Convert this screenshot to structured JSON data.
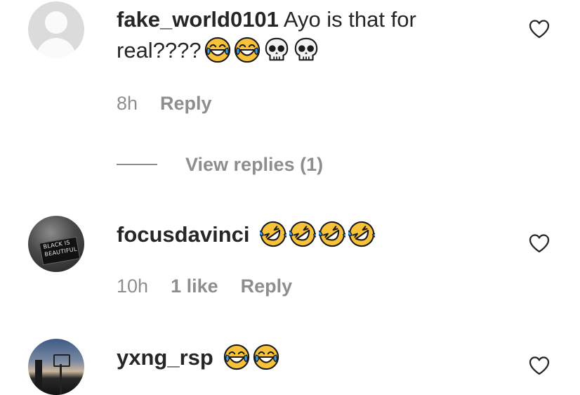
{
  "comments": [
    {
      "username": "fake_world0101",
      "text_line1": " Ayo is that for",
      "text_line2": "real????",
      "emojis_line2": [
        "joy-emoji",
        "joy-emoji",
        "skull-emoji",
        "skull-emoji"
      ],
      "time": "8h",
      "likes": "",
      "reply_label": "Reply",
      "avatar": "default-avatar",
      "view_replies_label": "View replies (1)"
    },
    {
      "username": "focusdavinci",
      "text": "",
      "emojis": [
        "rofl-emoji",
        "rofl-emoji",
        "rofl-emoji",
        "rofl-emoji"
      ],
      "time": "10h",
      "likes": "1 like",
      "reply_label": "Reply",
      "avatar": "black-is-beautiful-photo",
      "avatar_sign_line1": "BLACK IS",
      "avatar_sign_line2": "BEAUTIFUL"
    },
    {
      "username": "yxng_rsp",
      "text": "",
      "emojis": [
        "joy-emoji",
        "joy-emoji"
      ],
      "avatar": "basketball-hoop-photo"
    }
  ],
  "icons": {
    "like": "heart-outline-icon"
  },
  "colors": {
    "text_primary": "#262626",
    "text_secondary": "#8e8e8e",
    "emoji_yellow": "#f7c23a",
    "emoji_tear": "#3aa0e8"
  }
}
